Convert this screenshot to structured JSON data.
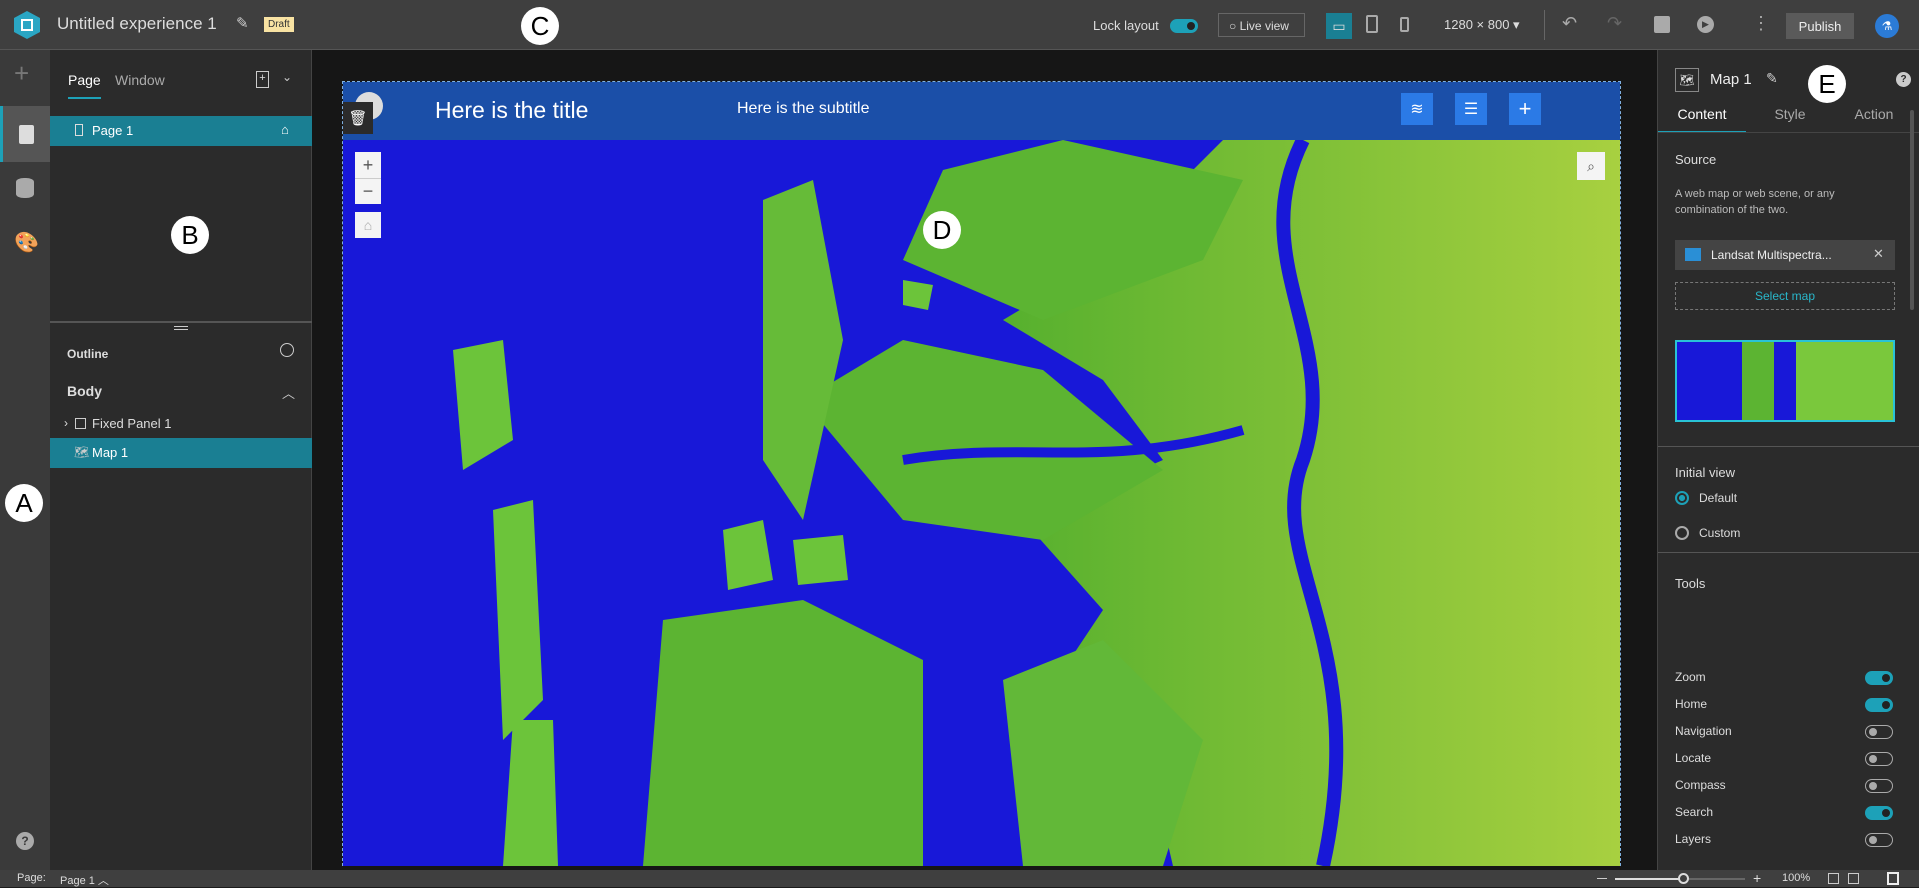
{
  "header": {
    "title": "Untitled experience 1",
    "badge": "Draft",
    "lock_layout": "Lock layout",
    "lock_layout_on": true,
    "live_view": "Live view",
    "resolution": "1280 × 800",
    "publish": "Publish"
  },
  "left_panel": {
    "tabs": [
      "Page",
      "Window"
    ],
    "active_tab": "Page",
    "pages": [
      {
        "label": "Page 1"
      }
    ],
    "outline_title": "Outline",
    "body_label": "Body",
    "outline_items": [
      {
        "label": "Fixed Panel 1"
      },
      {
        "label": "Map 1",
        "selected": true
      }
    ]
  },
  "canvas": {
    "title": "Here is the title",
    "subtitle": "Here is the subtitle"
  },
  "right_panel": {
    "widget_name": "Map 1",
    "tabs": [
      "Content",
      "Style",
      "Action"
    ],
    "active_tab": "Content",
    "source_label": "Source",
    "source_desc": "A web map or web scene, or any combination of the two.",
    "selected_map": "Landsat Multispectra...",
    "select_map": "Select map",
    "initial_view_label": "Initial view",
    "initial_view_options": [
      {
        "label": "Default",
        "checked": true
      },
      {
        "label": "Custom",
        "checked": false
      }
    ],
    "tools_label": "Tools",
    "tools": [
      {
        "label": "Zoom",
        "on": true
      },
      {
        "label": "Home",
        "on": true
      },
      {
        "label": "Navigation",
        "on": false
      },
      {
        "label": "Locate",
        "on": false
      },
      {
        "label": "Compass",
        "on": false
      },
      {
        "label": "Search",
        "on": true
      },
      {
        "label": "Layers",
        "on": false
      }
    ]
  },
  "bottom_bar": {
    "page_label": "Page:",
    "page_value": "Page 1",
    "zoom": "100%",
    "zoom_level_percent": 100
  },
  "markers": [
    "A",
    "B",
    "C",
    "D",
    "E"
  ],
  "colors": {
    "accent": "#1da1b8",
    "selection": "#1a7f93",
    "header_band": "#1b4fa8",
    "map_water": "#1818d8",
    "map_land": "#6cc43a"
  }
}
